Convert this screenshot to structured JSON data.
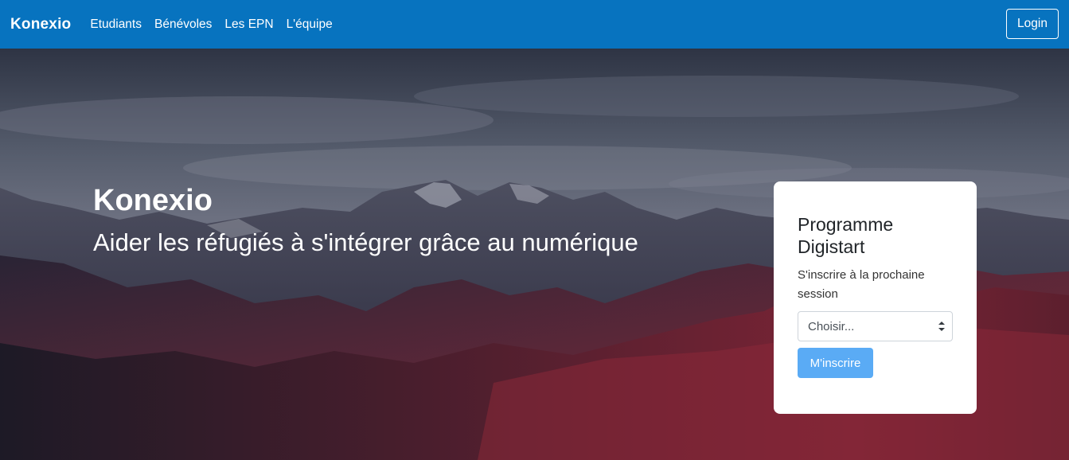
{
  "navbar": {
    "brand": "Konexio",
    "links": [
      "Etudiants",
      "Bénévoles",
      "Les EPN",
      "L'équipe"
    ],
    "login_label": "Login",
    "background": "#0773bf"
  },
  "hero": {
    "title": "Konexio",
    "subtitle": "Aider les réfugiés à s'intégrer grâce au numérique"
  },
  "signup_card": {
    "title": "Programme Digistart",
    "description": "S'inscrire à la prochaine session",
    "select": {
      "selected": "Choisir...",
      "caret_icon": "up-down-caret-icon"
    },
    "submit_label": "M'inscrire",
    "submit_color": "#5aabf5"
  }
}
